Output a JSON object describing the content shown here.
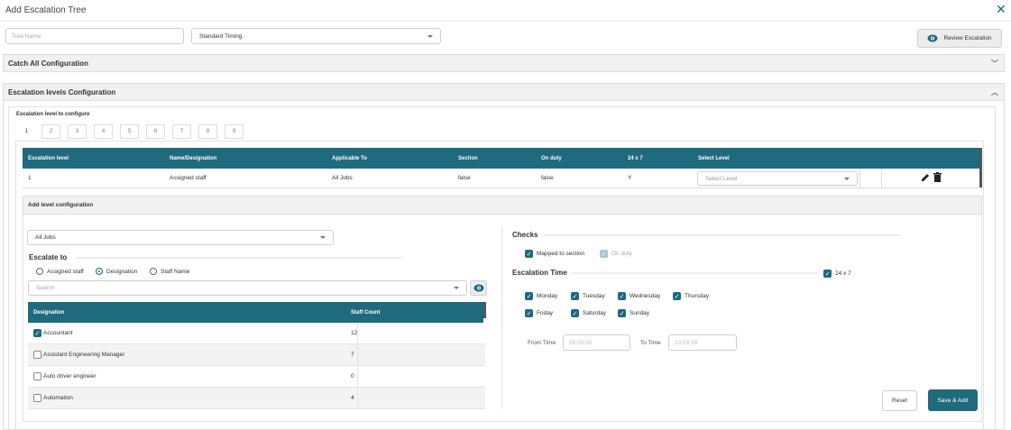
{
  "header": {
    "title": "Add Escalation Tree"
  },
  "top": {
    "tree_name_placeholder": "Tree Name",
    "timing_value": "Standard Timing",
    "review_label": "Review Escalation"
  },
  "panels": {
    "catch_all": "Catch All Configuration",
    "levels": "Escalation levels Configuration"
  },
  "levels_config": {
    "label": "Escalation level to configure",
    "tabs": [
      "1",
      "2",
      "3",
      "4",
      "5",
      "6",
      "7",
      "8",
      "9"
    ]
  },
  "level_table": {
    "headers": [
      "Escalation level",
      "Name/Designation",
      "Applicable To",
      "Section",
      "On duty",
      "24 x 7",
      "Select Level"
    ],
    "row": {
      "level": "1",
      "name": "Assigned staff",
      "applicable": "All Jobs",
      "section": "false",
      "on_duty": "false",
      "twentyfour": "Y",
      "select_placeholder": "Select Level"
    }
  },
  "add_level": {
    "title": "Add level configuration",
    "jobs_value": "All Jobs",
    "escalate_to_label": "Escalate to",
    "radios": [
      "Assigned staff",
      "Designation",
      "Staff Name"
    ],
    "search_placeholder": "Search",
    "table_headers": [
      "Designation",
      "Staff Count"
    ],
    "rows": [
      {
        "name": "Accountant",
        "count": "12",
        "checked": true
      },
      {
        "name": "Assistant Engineering Manager",
        "count": "7",
        "checked": false
      },
      {
        "name": "Auto driver engineer",
        "count": "0",
        "checked": false
      },
      {
        "name": "Automation",
        "count": "4",
        "checked": false
      }
    ]
  },
  "checks": {
    "label": "Checks",
    "mapped": "Mapped to section",
    "on_duty": "On duty"
  },
  "esc_time": {
    "label": "Escalation Time",
    "twentyfour": "24 x 7",
    "days": [
      "Monday",
      "Tuesday",
      "Wednesday",
      "Thursday",
      "Friday",
      "Saturday",
      "Sunday"
    ],
    "from_label": "From Time",
    "from_value": "00:00:00",
    "to_label": "To Time",
    "to_value": "23:59:59"
  },
  "actions": {
    "reset": "Reset",
    "save_add": "Save & Add"
  },
  "colors": {
    "accent": "#1f6a7c"
  }
}
